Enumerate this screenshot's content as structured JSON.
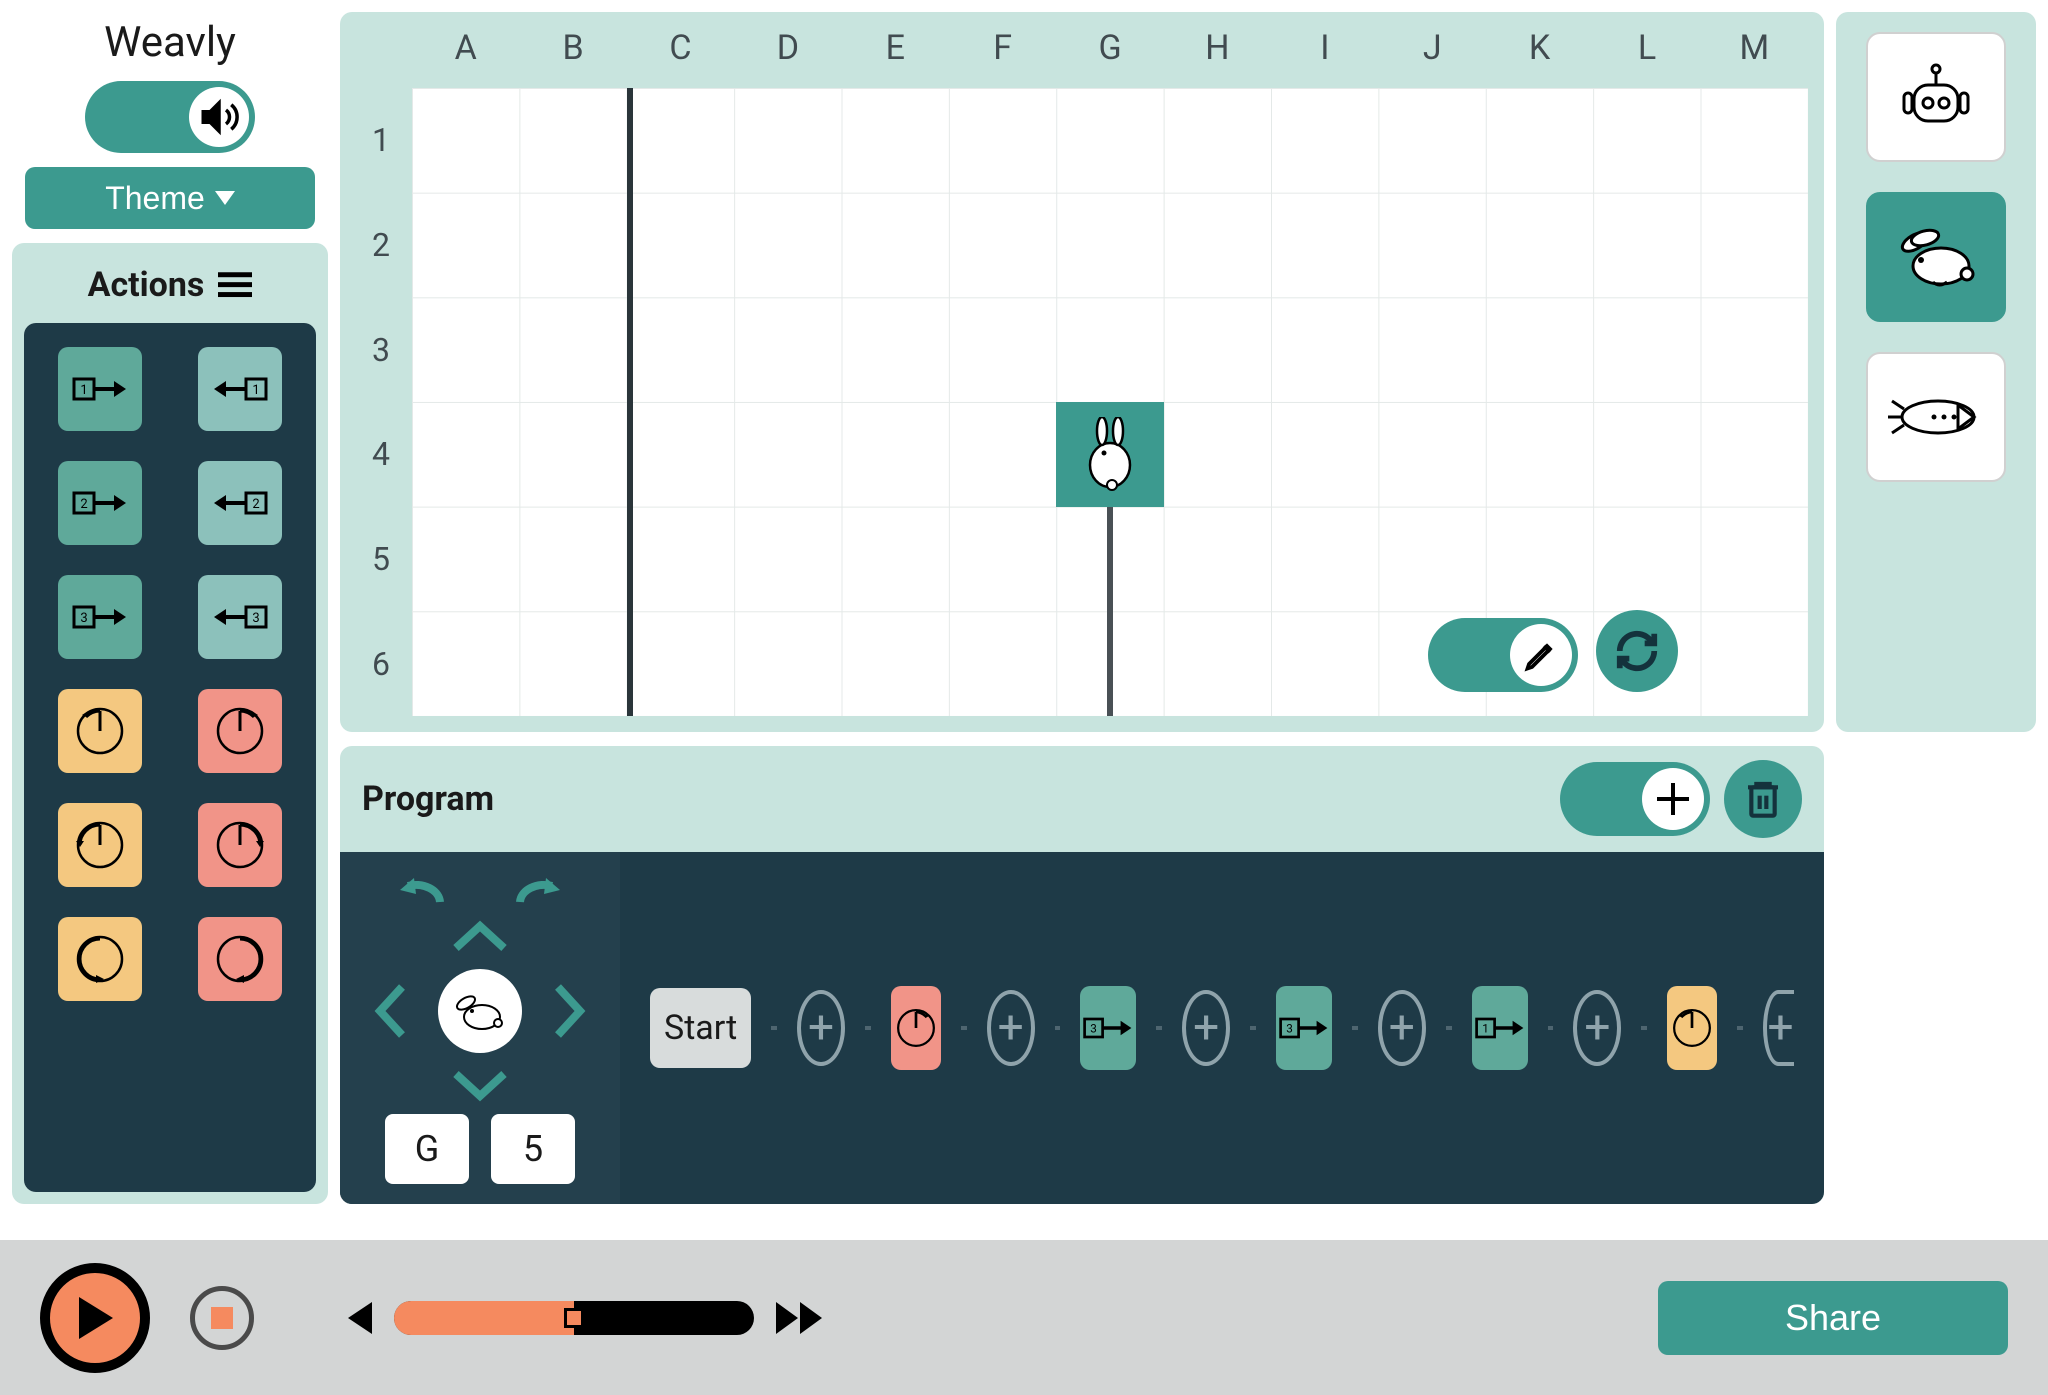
{
  "app_title": "Weavly",
  "theme_button": "Theme",
  "actions_title": "Actions",
  "program_title": "Program",
  "share_button": "Share",
  "scene": {
    "columns": [
      "A",
      "B",
      "C",
      "D",
      "E",
      "F",
      "G",
      "H",
      "I",
      "J",
      "K",
      "L",
      "M"
    ],
    "rows": [
      "1",
      "2",
      "3",
      "4",
      "5",
      "6"
    ],
    "position_col": "G",
    "position_row": "5"
  },
  "sequence": {
    "start_label": "Start"
  }
}
